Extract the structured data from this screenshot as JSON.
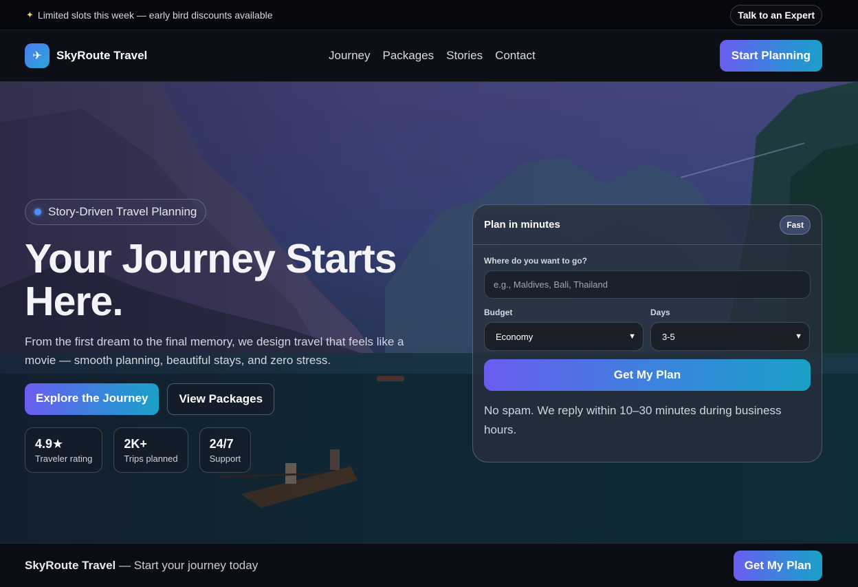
{
  "announcement": {
    "icon": "sparkle-icon",
    "text": "Limited slots this week — early bird discounts available",
    "expert_button": "Talk to an Expert"
  },
  "nav": {
    "logo_icon": "airplane-icon",
    "brand": "SkyRoute Travel",
    "links": [
      "Journey",
      "Packages",
      "Stories",
      "Contact"
    ],
    "cta": "Start Planning"
  },
  "hero": {
    "pill": "Story-Driven Travel Planning",
    "headline": "Your Journey Starts Here.",
    "subcopy": "From the first dream to the final memory, we design travel that feels like a movie — smooth planning, beautiful stays, and zero stress.",
    "primary_cta": "Explore the Journey",
    "secondary_cta": "View Packages",
    "stats": [
      {
        "value": "4.9★",
        "label": "Traveler rating"
      },
      {
        "value": "2K+",
        "label": "Trips planned"
      },
      {
        "value": "24/7",
        "label": "Support"
      }
    ]
  },
  "plan_card": {
    "title": "Plan in minutes",
    "badge": "Fast",
    "destination_label": "Where do you want to go?",
    "destination_placeholder": "e.g., Maldives, Bali, Thailand",
    "destination_value": "",
    "budget_label": "Budget",
    "budget_value": "Economy",
    "days_label": "Days",
    "days_value": "3-5",
    "submit": "Get My Plan",
    "note": "No spam. We reply within 10–30 minutes during business hours."
  },
  "bottom_bar": {
    "brand": "SkyRoute Travel",
    "tagline": " — Start your journey today",
    "cta": "Get My Plan"
  },
  "colors": {
    "accent_start": "#6a5cf0",
    "accent_end": "#1ba0c6",
    "dot": "#4f8ef7"
  }
}
